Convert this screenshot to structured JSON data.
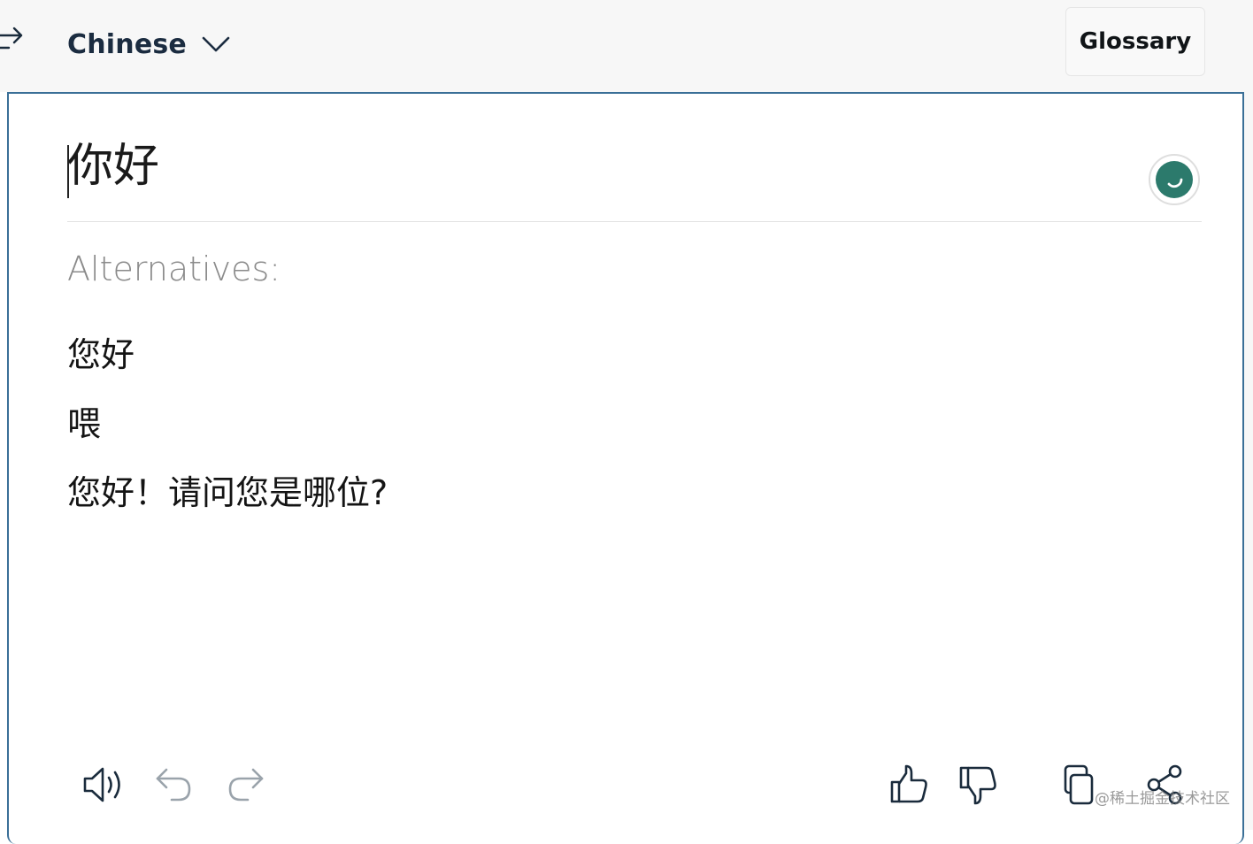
{
  "header": {
    "target_language": "Chinese",
    "glossary_label": "Glossary"
  },
  "translation": {
    "text": "你好"
  },
  "alternatives": {
    "label": "Alternatives:",
    "items": [
      "您好",
      "喂",
      "您好！请问您是哪位?"
    ]
  },
  "toolbar": {
    "icons": [
      "speaker-icon",
      "undo-icon",
      "redo-icon",
      "thumbs-up-icon",
      "thumbs-down-icon",
      "copy-icon",
      "share-icon"
    ]
  },
  "watermark": "@稀土掘金技术社区",
  "colors": {
    "accent_border": "#3a6f97",
    "language_text": "#1b2c40",
    "spinner": "#2c7a6c",
    "muted_text": "#8a8a8a",
    "icon": "#1a2b3c"
  }
}
